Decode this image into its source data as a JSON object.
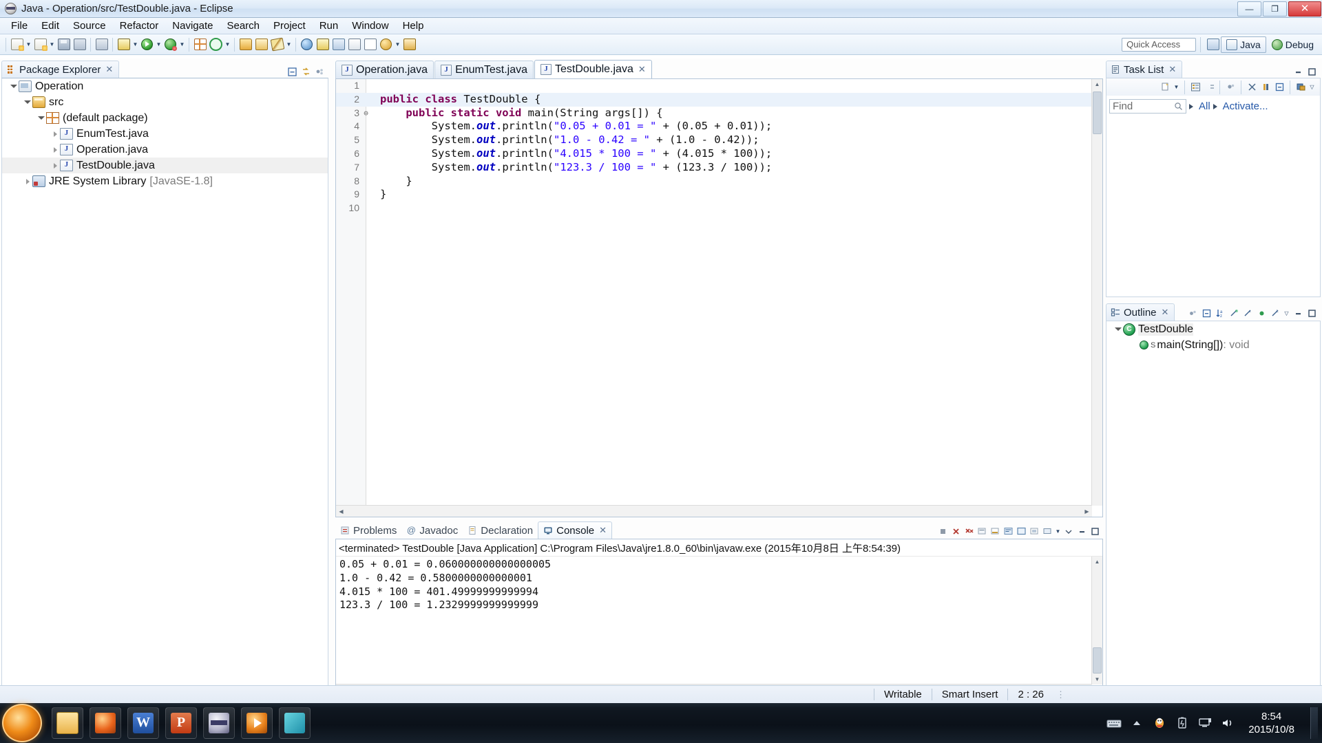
{
  "window": {
    "title": "Java - Operation/src/TestDouble.java - Eclipse",
    "minimize_label": "—",
    "maximize_label": "❐",
    "close_label": "✕"
  },
  "menubar": {
    "items": [
      "File",
      "Edit",
      "Source",
      "Refactor",
      "Navigate",
      "Search",
      "Project",
      "Run",
      "Window",
      "Help"
    ]
  },
  "toolbar": {
    "quick_access_placeholder": "Quick Access",
    "perspectives": [
      {
        "label": "Java",
        "icon": "java-perspective-icon",
        "active": true
      },
      {
        "label": "Debug",
        "icon": "debug-perspective-icon",
        "active": false
      }
    ],
    "buttons": [
      {
        "name": "new-wizard",
        "icon": "new-document-icon",
        "has_caret": true
      },
      {
        "name": "new-java-file",
        "icon": "new-java-file-icon",
        "has_caret": true
      },
      {
        "name": "save",
        "icon": "save-icon",
        "has_caret": false
      },
      {
        "name": "save-all",
        "icon": "save-all-icon",
        "has_caret": false
      },
      {
        "name": "print",
        "icon": "print-icon",
        "has_caret": false
      },
      {
        "name": "build-all",
        "icon": "build-icon",
        "has_caret": true
      },
      {
        "name": "run",
        "icon": "run-icon",
        "has_caret": true
      },
      {
        "name": "debug",
        "icon": "debug-icon",
        "has_caret": true
      },
      {
        "name": "new-package",
        "icon": "package-icon",
        "has_caret": false
      },
      {
        "name": "external-tools",
        "icon": "external-tools-icon",
        "has_caret": true
      },
      {
        "name": "open-type",
        "icon": "open-type-icon",
        "has_caret": false
      },
      {
        "name": "open-task",
        "icon": "open-task-icon",
        "has_caret": false
      },
      {
        "name": "annotation",
        "icon": "annotation-icon",
        "has_caret": true
      },
      {
        "name": "search",
        "icon": "search-icon",
        "has_caret": false
      },
      {
        "name": "perspective-open",
        "icon": "perspective-icon",
        "has_caret": false
      },
      {
        "name": "link-editor",
        "icon": "link-icon",
        "has_caret": false
      },
      {
        "name": "toggle-book",
        "icon": "book-icon",
        "has_caret": false
      },
      {
        "name": "toggle-mark",
        "icon": "text-marker-icon",
        "has_caret": false
      },
      {
        "name": "next-annotation",
        "icon": "next-annotation-icon",
        "has_caret": true
      },
      {
        "name": "prev-annotation",
        "icon": "prev-annotation-icon",
        "has_caret": false
      }
    ]
  },
  "package_explorer": {
    "title": "Package Explorer",
    "close_glyph": "✕",
    "tools": [
      "collapse-all-icon",
      "link-with-editor-icon",
      "view-menu-icon"
    ],
    "tree": [
      {
        "label": "Operation",
        "indent": 0,
        "arrow": "down",
        "icon": "project-icon",
        "selected": false,
        "suffix": ""
      },
      {
        "label": "src",
        "indent": 1,
        "arrow": "down",
        "icon": "source-folder-icon",
        "selected": false,
        "suffix": ""
      },
      {
        "label": "(default package)",
        "indent": 2,
        "arrow": "down",
        "icon": "package-icon",
        "selected": false,
        "suffix": ""
      },
      {
        "label": "EnumTest.java",
        "indent": 3,
        "arrow": "right",
        "icon": "java-file-icon",
        "selected": false,
        "suffix": ""
      },
      {
        "label": "Operation.java",
        "indent": 3,
        "arrow": "right",
        "icon": "java-file-icon",
        "selected": false,
        "suffix": ""
      },
      {
        "label": "TestDouble.java",
        "indent": 3,
        "arrow": "right",
        "icon": "java-file-icon",
        "selected": true,
        "suffix": ""
      },
      {
        "label": "JRE System Library",
        "indent": 1,
        "arrow": "right",
        "icon": "jre-library-icon",
        "selected": false,
        "suffix": "[JavaSE-1.8]"
      }
    ]
  },
  "editor": {
    "tabs": [
      {
        "label": "Operation.java",
        "active": false,
        "closable": false
      },
      {
        "label": "EnumTest.java",
        "active": false,
        "closable": false
      },
      {
        "label": "TestDouble.java",
        "active": true,
        "closable": true
      }
    ],
    "close_glyph": "✕",
    "minimize_glyph": "—",
    "maximize_glyph": "❐",
    "lines": [
      {
        "no": "1",
        "fold": "",
        "highlight": false,
        "code": ""
      },
      {
        "no": "2",
        "fold": "",
        "highlight": true,
        "code": "public class TestDouble {"
      },
      {
        "no": "3",
        "fold": "⊖",
        "highlight": false,
        "code": "    public static void main(String args[]) {"
      },
      {
        "no": "4",
        "fold": "",
        "highlight": false,
        "code": "        System.out.println(\"0.05 + 0.01 = \" + (0.05 + 0.01));"
      },
      {
        "no": "5",
        "fold": "",
        "highlight": false,
        "code": "        System.out.println(\"1.0 - 0.42 = \" + (1.0 - 0.42));"
      },
      {
        "no": "6",
        "fold": "",
        "highlight": false,
        "code": "        System.out.println(\"4.015 * 100 = \" + (4.015 * 100));"
      },
      {
        "no": "7",
        "fold": "",
        "highlight": false,
        "code": "        System.out.println(\"123.3 / 100 = \" + (123.3 / 100));"
      },
      {
        "no": "8",
        "fold": "",
        "highlight": false,
        "code": "    }"
      },
      {
        "no": "9",
        "fold": "",
        "highlight": false,
        "code": "}"
      },
      {
        "no": "10",
        "fold": "",
        "highlight": false,
        "code": ""
      }
    ]
  },
  "console": {
    "tabs": [
      {
        "label": "Problems",
        "icon": "problems-icon",
        "active": false
      },
      {
        "label": "Javadoc",
        "icon": "javadoc-icon",
        "active": false
      },
      {
        "label": "Declaration",
        "icon": "declaration-icon",
        "active": false
      },
      {
        "label": "Console",
        "icon": "console-icon",
        "active": true
      }
    ],
    "close_glyph": "✕",
    "header": "<terminated> TestDouble [Java Application] C:\\Program Files\\Java\\jre1.8.0_60\\bin\\javaw.exe (2015年10月8日 上午8:54:39)",
    "output": "0.05 + 0.01 = 0.060000000000000005\n1.0 - 0.42 = 0.5800000000000001\n4.015 * 100 = 401.49999999999994\n123.3 / 100 = 1.2329999999999999",
    "tools": [
      "terminate-icon",
      "remove-launch-icon",
      "remove-all-icon",
      "clear-console-icon",
      "scroll-lock-icon",
      "word-wrap-icon",
      "pin-console-icon",
      "display-console-icon",
      "open-console-icon",
      "view-menu-icon"
    ]
  },
  "task_list": {
    "title": "Task List",
    "close_glyph": "✕",
    "find_placeholder": "Find",
    "filters": [
      {
        "label": "All"
      },
      {
        "label": "Activate..."
      }
    ],
    "tools": [
      "new-task-icon",
      "categorize-icon",
      "schedule-icon",
      "presentation-icon",
      "filter-icon",
      "focus-icon",
      "collapse-all-icon",
      "synchronize-icon",
      "view-menu-icon"
    ],
    "minimize_glyph": "—",
    "maximize_glyph": "❐"
  },
  "outline": {
    "title": "Outline",
    "close_glyph": "✕",
    "tools": [
      "link-icon",
      "collapse-all-icon",
      "sort-icon",
      "hide-fields-icon",
      "hide-static-icon",
      "hide-nonpublic-icon",
      "hide-local-icon",
      "view-menu-icon"
    ],
    "minimize_glyph": "—",
    "maximize_glyph": "❐",
    "nodes": [
      {
        "label": "TestDouble",
        "indent": 0,
        "arrow": "down",
        "icon": "class-icon",
        "badge": "",
        "selected": true,
        "suffix": ""
      },
      {
        "label": "main(String[])",
        "indent": 1,
        "arrow": "",
        "icon": "method-public-icon",
        "badge": "S",
        "selected": false,
        "suffix": " : void"
      }
    ]
  },
  "statusbar": {
    "writable": "Writable",
    "insert_mode": "Smart Insert",
    "position": "2 : 26"
  },
  "taskbar": {
    "start_label": "start-button",
    "apps": [
      {
        "name": "file-explorer",
        "icon": "explorer-icon"
      },
      {
        "name": "firefox",
        "icon": "firefox-icon"
      },
      {
        "name": "word",
        "icon": "word-icon",
        "glyph": "W"
      },
      {
        "name": "powerpoint",
        "icon": "powerpoint-icon",
        "glyph": "P"
      },
      {
        "name": "eclipse",
        "icon": "eclipse-icon"
      },
      {
        "name": "media-player",
        "icon": "media-player-icon"
      },
      {
        "name": "other-app",
        "icon": "teal-app-icon"
      }
    ],
    "tray": [
      "keyboard-icon",
      "show-hidden-icon",
      "qq-icon",
      "battery-icon",
      "network-icon",
      "volume-icon"
    ],
    "clock_time": "8:54",
    "clock_date": "2015/10/8"
  }
}
